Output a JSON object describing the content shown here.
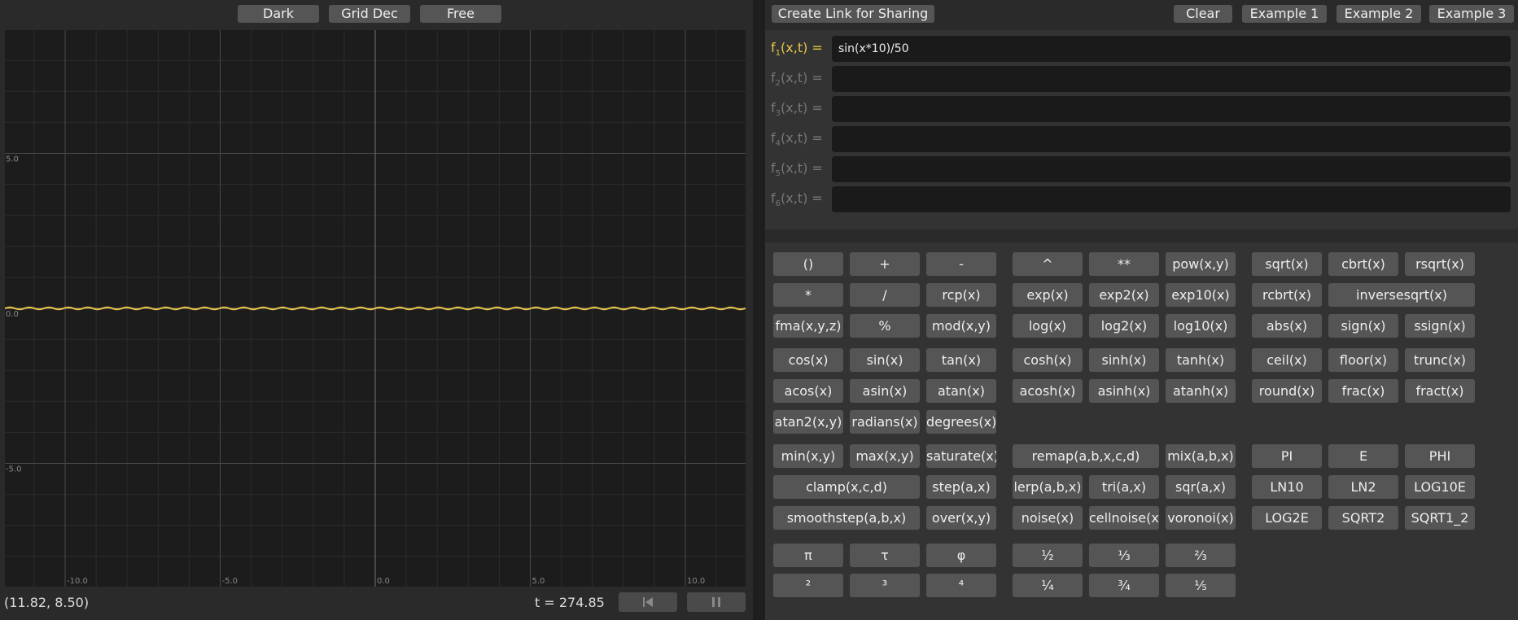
{
  "colors": {
    "accent": "#e8c547",
    "grid_bg": "#1c1c1c",
    "button_bg": "#555555"
  },
  "toolbar_left": {
    "theme": "Dark",
    "grid": "Grid Dec",
    "mode": "Free"
  },
  "graph": {
    "x_ticks": [
      "-10.0",
      "-5.0",
      "0.0",
      "5.0",
      "10.0"
    ],
    "y_ticks": [
      "5.0",
      "0.0",
      "-5.0"
    ],
    "curve_expression": "sin(x*10)/50"
  },
  "status": {
    "coords": "(11.82, 8.50)",
    "time": "t = 274.85"
  },
  "controls": {
    "rewind_icon": "skip-back-icon",
    "pause_icon": "pause-icon"
  },
  "toolbar_right": {
    "share": "Create Link for Sharing",
    "clear": "Clear",
    "ex1": "Example 1",
    "ex2": "Example 2",
    "ex3": "Example 3"
  },
  "functions": [
    {
      "name": "f",
      "sub": "1",
      "args": "(x,t) =",
      "value": "sin(x*10)/50"
    },
    {
      "name": "f",
      "sub": "2",
      "args": "(x,t) =",
      "value": ""
    },
    {
      "name": "f",
      "sub": "3",
      "args": "(x,t) =",
      "value": ""
    },
    {
      "name": "f",
      "sub": "4",
      "args": "(x,t) =",
      "value": ""
    },
    {
      "name": "f",
      "sub": "5",
      "args": "(x,t) =",
      "value": ""
    },
    {
      "name": "f",
      "sub": "6",
      "args": "(x,t) =",
      "value": ""
    }
  ],
  "keypad": {
    "basic": [
      [
        "()",
        "+",
        "-"
      ],
      [
        "*",
        "/",
        "rcp(x)"
      ],
      [
        "fma(x,y,z)",
        "%",
        "mod(x,y)"
      ]
    ],
    "power": [
      [
        "^",
        "**",
        "pow(x,y)"
      ],
      [
        "exp(x)",
        "exp2(x)",
        "exp10(x)"
      ],
      [
        "log(x)",
        "log2(x)",
        "log10(x)"
      ]
    ],
    "roots": [
      [
        "sqrt(x)",
        "cbrt(x)",
        "rsqrt(x)"
      ],
      [
        "rcbrt(x)",
        "inversesqrt(x)"
      ],
      [
        "abs(x)",
        "sign(x)",
        "ssign(x)"
      ]
    ],
    "trig": [
      [
        "cos(x)",
        "sin(x)",
        "tan(x)"
      ],
      [
        "acos(x)",
        "asin(x)",
        "atan(x)"
      ],
      [
        "atan2(x,y)",
        "radians(x)",
        "degrees(x)"
      ]
    ],
    "hyper": [
      [
        "cosh(x)",
        "sinh(x)",
        "tanh(x)"
      ],
      [
        "acosh(x)",
        "asinh(x)",
        "atanh(x)"
      ]
    ],
    "rounding": [
      [
        "ceil(x)",
        "floor(x)",
        "trunc(x)"
      ],
      [
        "round(x)",
        "frac(x)",
        "fract(x)"
      ]
    ],
    "minmax": [
      [
        "min(x,y)",
        "max(x,y)",
        "saturate(x)"
      ],
      [
        "clamp(x,c,d)",
        "step(a,x)"
      ],
      [
        "smoothstep(a,b,x)",
        "over(x,y)"
      ]
    ],
    "interp": [
      [
        "remap(a,b,x,c,d)",
        "mix(a,b,x)"
      ],
      [
        "lerp(a,b,x)",
        "tri(a,x)",
        "sqr(a,x)"
      ],
      [
        "noise(x)",
        "cellnoise(x)",
        "voronoi(x)"
      ]
    ],
    "constants": [
      [
        "PI",
        "E",
        "PHI"
      ],
      [
        "LN10",
        "LN2",
        "LOG10E"
      ],
      [
        "LOG2E",
        "SQRT2",
        "SQRT1_2"
      ]
    ],
    "symbols": [
      [
        "π",
        "τ",
        "φ"
      ],
      [
        "²",
        "³",
        "⁴"
      ]
    ],
    "fractions": [
      [
        "½",
        "⅓",
        "⅔"
      ],
      [
        "¼",
        "¾",
        "⅕"
      ]
    ]
  }
}
